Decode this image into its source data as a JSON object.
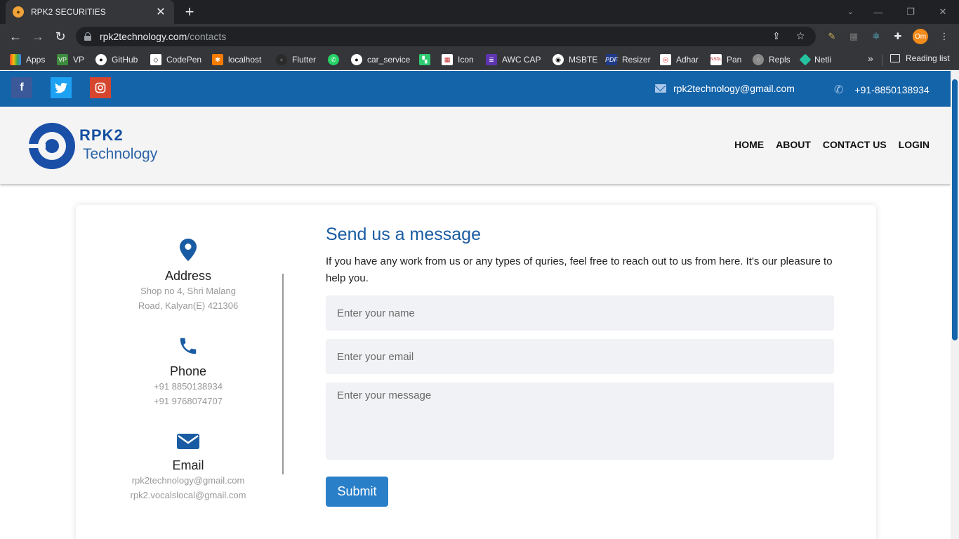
{
  "browser": {
    "tab_title": "RPK2 SECURITIES",
    "url_host": "rpk2technology.com",
    "url_path": "/contacts",
    "profile_initials": "Om",
    "bookmarks": [
      "Apps",
      "VP",
      "GitHub",
      "CodePen",
      "localhost",
      "Flutter",
      "car_service",
      "Icon",
      "AWC CAP",
      "MSBTE",
      "Resizer",
      "Adhar",
      "Pan",
      "Repls",
      "Netli"
    ],
    "more": "»",
    "reading_list": "Reading list"
  },
  "topbar": {
    "email": "rpk2technology@gmail.com",
    "phone": "+91-8850138934",
    "social": [
      "f",
      "t",
      "ig"
    ]
  },
  "brand": {
    "line1": "RPK2",
    "line2": "Technology"
  },
  "nav": [
    "HOME",
    "ABOUT",
    "CONTACT US",
    "LOGIN"
  ],
  "contact_info": {
    "address": {
      "title": "Address",
      "lines": [
        "Shop no 4, Shri Malang",
        "Road, Kalyan(E) 421306"
      ]
    },
    "phone": {
      "title": "Phone",
      "lines": [
        "+91 8850138934",
        "+91 9768074707"
      ]
    },
    "email": {
      "title": "Email",
      "lines": [
        "rpk2technology@gmail.com",
        "rpk2.vocalslocal@gmail.com"
      ]
    }
  },
  "form": {
    "title": "Send us a message",
    "description": "If you have any work from us or any types of quries, feel free to reach out to us from here. It's our pleasure to help you.",
    "name_placeholder": "Enter your name",
    "email_placeholder": "Enter your email",
    "message_placeholder": "Enter your message",
    "submit_label": "Submit"
  },
  "colors": {
    "primary": "#1464aa",
    "button": "#2a7fc9",
    "heading": "#1a5ca3"
  }
}
